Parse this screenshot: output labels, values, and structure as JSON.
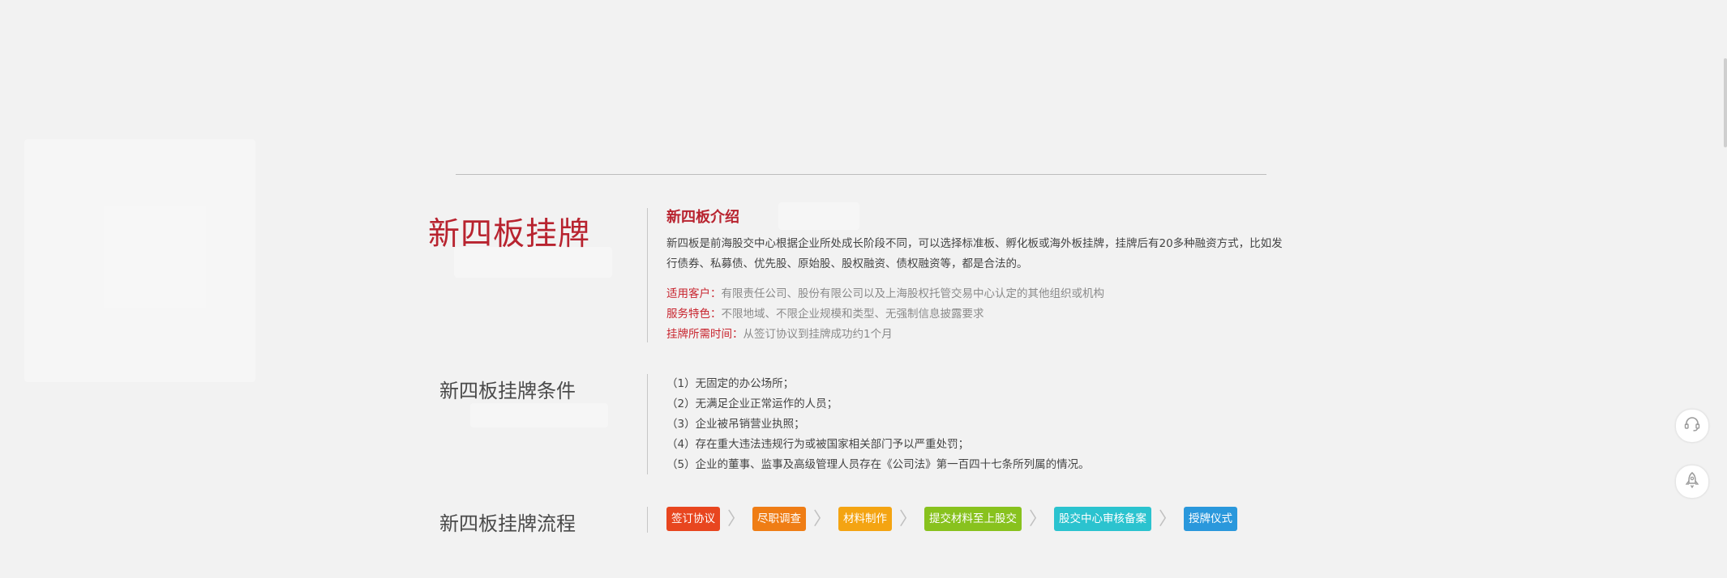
{
  "intro": {
    "main_title": "新四板挂牌",
    "heading": "新四板介绍",
    "body": "新四板是前海股交中心根据企业所处成长阶段不同，可以选择标准板、孵化板或海外板挂牌，挂牌后有20多种融资方式，比如发行债券、私募债、优先股、原始股、股权融资、债权融资等，都是合法的。",
    "info": [
      {
        "label": "适用客户：",
        "value": "有限责任公司、股份有限公司以及上海股权托管交易中心认定的其他组织或机构"
      },
      {
        "label": "服务特色：",
        "value": "不限地域、不限企业规模和类型、无强制信息披露要求"
      },
      {
        "label": "挂牌所需时间：",
        "value": "从签订协议到挂牌成功约1个月"
      }
    ]
  },
  "conditions": {
    "title": "新四板挂牌条件",
    "items": [
      "（1）无固定的办公场所；",
      "（2）无满足企业正常运作的人员；",
      "（3）企业被吊销营业执照；",
      "（4）存在重大违法违规行为或被国家相关部门予以严重处罚；",
      "（5）企业的董事、监事及高级管理人员存在《公司法》第一百四十七条所列属的情况。"
    ]
  },
  "process": {
    "title": "新四板挂牌流程",
    "steps": [
      {
        "label": "签订协议",
        "color": "#e8461f"
      },
      {
        "label": "尽职调查",
        "color": "#ef7d15"
      },
      {
        "label": "材料制作",
        "color": "#f4a412"
      },
      {
        "label": "提交材料至上股交",
        "color": "#88c21e"
      },
      {
        "label": "股交中心审核备案",
        "color": "#2bc3cf"
      },
      {
        "label": "授牌仪式",
        "color": "#2a98dc"
      }
    ],
    "separator": "〉"
  },
  "tools": {
    "icons": [
      "customer-service-icon",
      "rocket-icon"
    ]
  }
}
